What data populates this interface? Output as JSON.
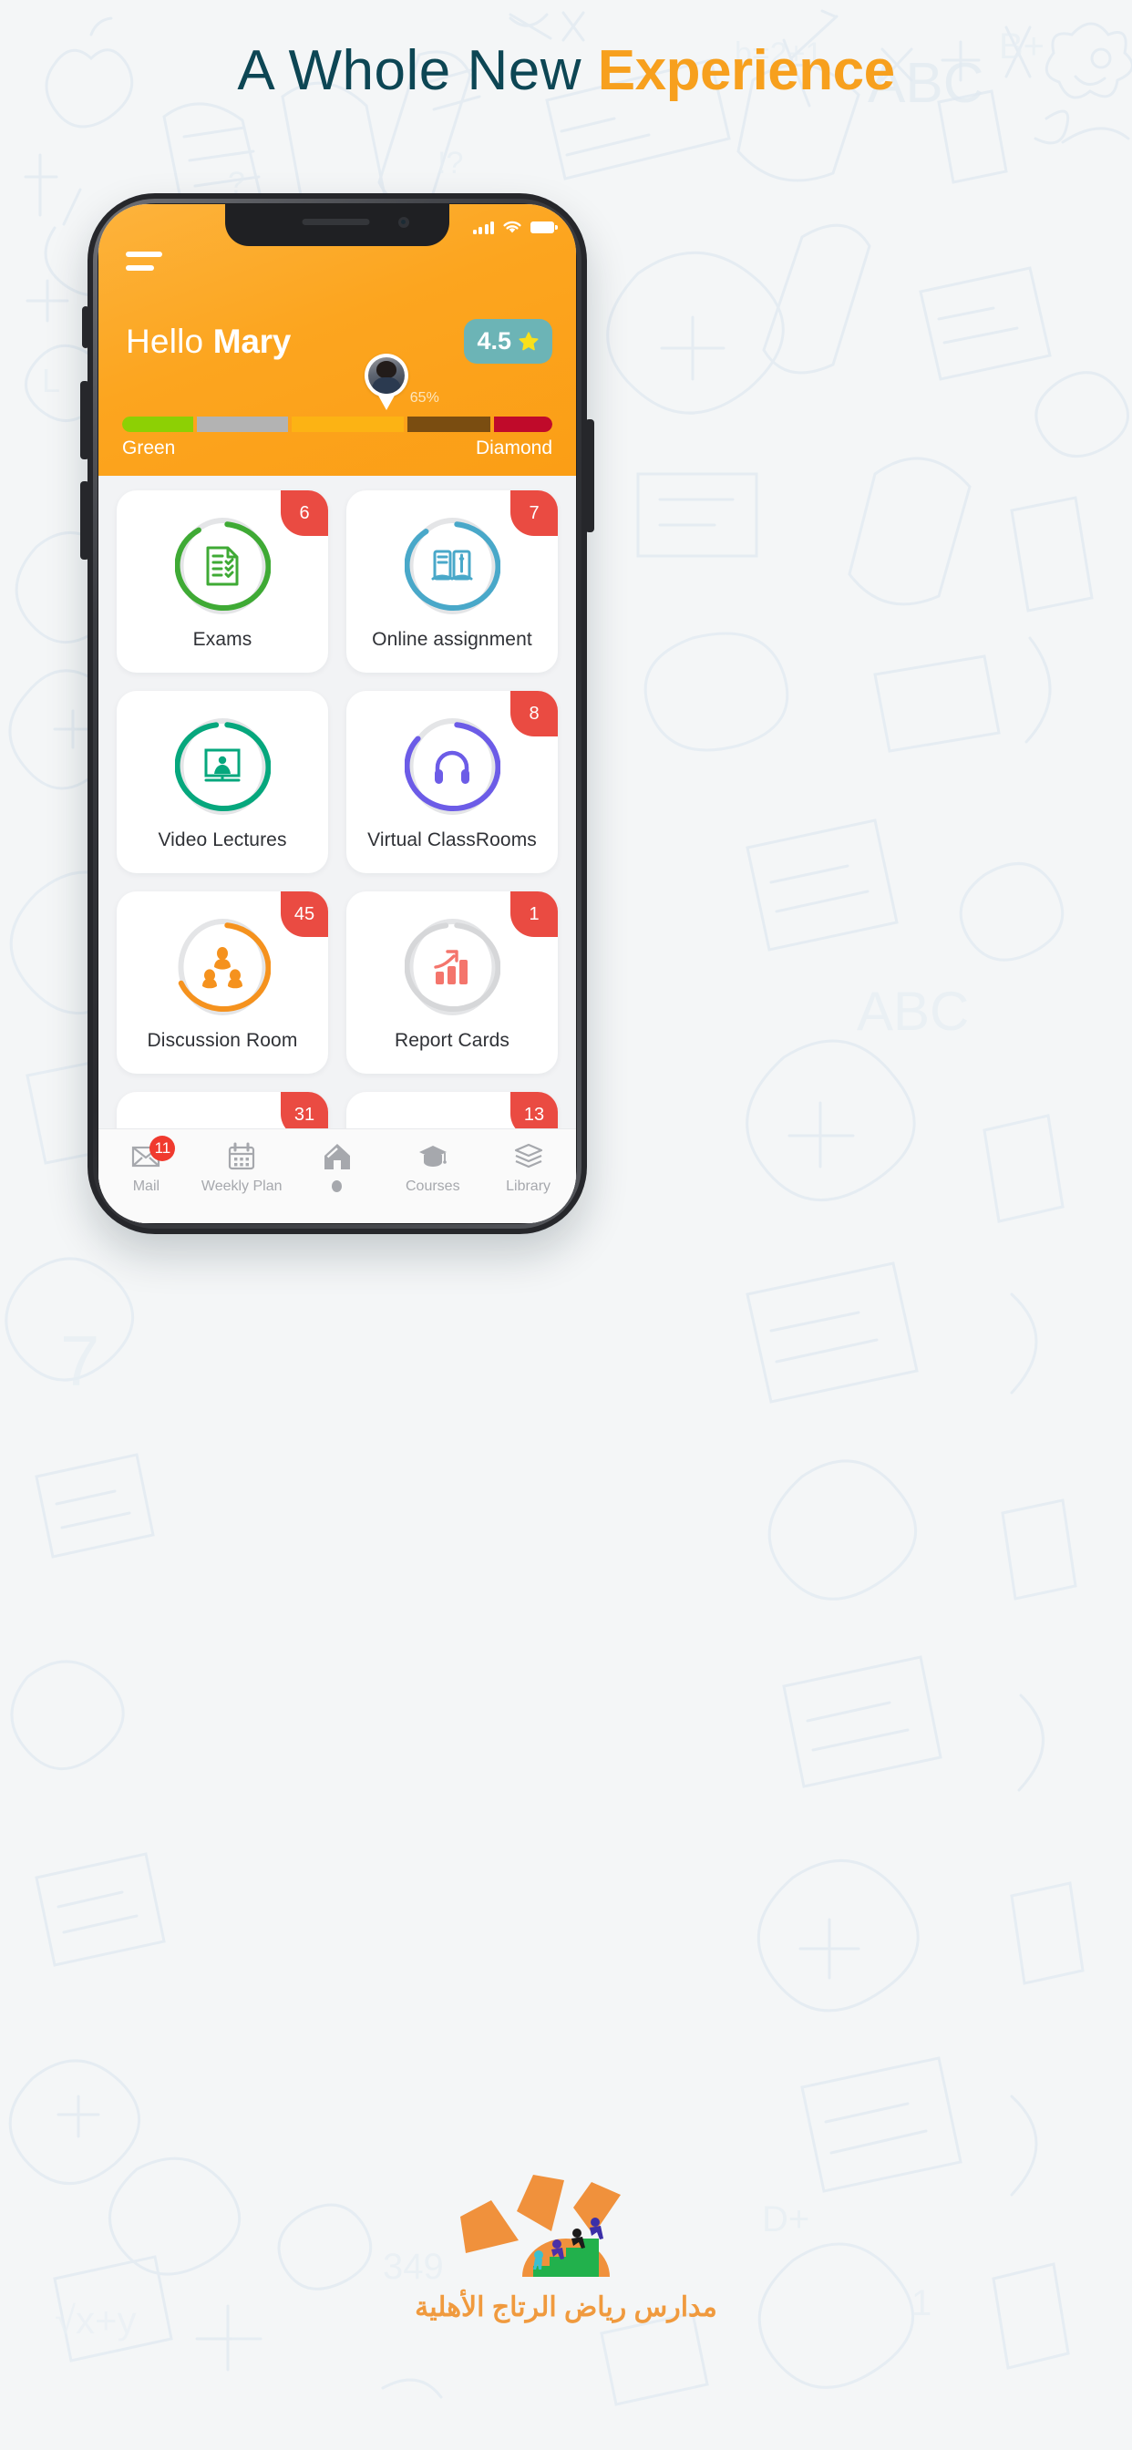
{
  "headline": {
    "plain": "A Whole New ",
    "accent": "Experience",
    "color_plain": "#0d4654",
    "color_accent": "#f7a01e"
  },
  "phone": {
    "statusbar": {
      "signal_icon": "cellular-signal-icon",
      "wifi_icon": "wifi-icon",
      "battery_icon": "battery-full-icon"
    },
    "header": {
      "menu_icon": "hamburger-menu-icon",
      "greeting_prefix": "Hello ",
      "user_name": "Mary",
      "rating_value": "4.5",
      "rating_star_icon": "star-icon",
      "rating_badge_color": "#6cb4b6",
      "background_color": "#fca51f",
      "progress": {
        "percent_label": "65%",
        "percent_value": 65,
        "start_label": "Green",
        "end_label": "Diamond",
        "avatar_icon": "user-avatar-pin",
        "segments": [
          {
            "name": "green",
            "color": "#8dd004",
            "width": 17
          },
          {
            "name": "silver",
            "color": "#b3b3b3",
            "width": 22
          },
          {
            "name": "gold",
            "color": "#fcb314",
            "width": 27
          },
          {
            "name": "bronze",
            "color": "#7a4d11",
            "width": 20
          },
          {
            "name": "diamond",
            "color": "#c00a2a",
            "width": 14
          }
        ]
      }
    },
    "cards": [
      {
        "label": "Exams",
        "badge": "6",
        "ring_color": "#3faa35",
        "ring_pct": 93,
        "icon": "exam-checklist-icon"
      },
      {
        "label": "Online assignment",
        "badge": "7",
        "ring_color": "#49a8c9",
        "ring_pct": 92,
        "icon": "books-pencil-icon"
      },
      {
        "label": "Video Lectures",
        "badge": "",
        "ring_color": "#06a77d",
        "ring_pct": 100,
        "icon": "video-lecture-icon"
      },
      {
        "label": "Virtual ClassRooms",
        "badge": "8",
        "ring_color": "#6c5ce7",
        "ring_pct": 88,
        "icon": "headphones-icon"
      },
      {
        "label": "Discussion Room",
        "badge": "45",
        "ring_color": "#f5921e",
        "ring_pct": 70,
        "icon": "discussion-group-icon"
      },
      {
        "label": "Report Cards",
        "badge": "1",
        "ring_color": "#d6d7d9",
        "ring_pct": 100,
        "icon": "bar-chart-growth-icon"
      },
      {
        "label": "",
        "badge": "31",
        "ring_color": "#3b82c4",
        "ring_pct": 80,
        "icon": "ring-only-icon"
      },
      {
        "label": "",
        "badge": "13",
        "ring_color": "#2b8764",
        "ring_pct": 80,
        "icon": "ring-only-icon"
      }
    ],
    "bottom_nav": [
      {
        "label": "Mail",
        "icon": "mail-envelope-icon",
        "badge": "11",
        "active": false
      },
      {
        "label": "Weekly Plan",
        "icon": "calendar-icon",
        "badge": "",
        "active": false
      },
      {
        "label": "",
        "icon": "home-icon",
        "badge": "",
        "active": true
      },
      {
        "label": "Courses",
        "icon": "graduation-cap-icon",
        "badge": "",
        "active": false
      },
      {
        "label": "Library",
        "icon": "books-stack-icon",
        "badge": "",
        "active": false
      }
    ]
  },
  "footer": {
    "logo_icon": "school-sun-logo",
    "logo_text": "مدارس رياض الرتاج الأهلية",
    "logo_color": "#f09a3e"
  }
}
